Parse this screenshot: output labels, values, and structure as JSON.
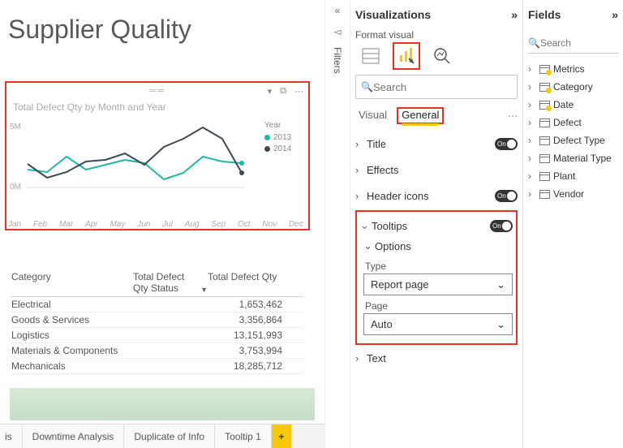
{
  "title": "Supplier Quality",
  "chart": {
    "title": "Total Defect Qty by Month and Year",
    "legend_title": "Year",
    "series": [
      {
        "name": "2013",
        "color": "#1fb8a3"
      },
      {
        "name": "2014",
        "color": "#3b4a54"
      }
    ],
    "y_ticks": [
      "5M",
      "0M"
    ],
    "x_ticks": [
      "Jan",
      "Feb",
      "Mar",
      "Apr",
      "May",
      "Jun",
      "Jul",
      "Aug",
      "Sep",
      "Oct",
      "Nov",
      "Dec"
    ]
  },
  "chart_data": {
    "type": "line",
    "title": "Total Defect Qty by Month and Year",
    "xlabel": "",
    "ylabel": "",
    "ylim": [
      0,
      6000000
    ],
    "categories": [
      "Jan",
      "Feb",
      "Mar",
      "Apr",
      "May",
      "Jun",
      "Jul",
      "Aug",
      "Sep",
      "Oct",
      "Nov",
      "Dec"
    ],
    "series": [
      {
        "name": "2013",
        "values": [
          1600000,
          1400000,
          2800000,
          1600000,
          2000000,
          2400000,
          2100000,
          700000,
          1300000,
          2700000,
          2300000,
          2200000
        ]
      },
      {
        "name": "2014",
        "values": [
          2100000,
          800000,
          1400000,
          2300000,
          2500000,
          3100000,
          2000000,
          3700000,
          4400000,
          5500000,
          4500000,
          1300000
        ]
      }
    ]
  },
  "table": {
    "headers": {
      "category": "Category",
      "status": "Total Defect Qty Status",
      "qty": "Total Defect Qty"
    },
    "rows": [
      {
        "category": "Electrical",
        "qty": "1,653,462"
      },
      {
        "category": "Goods & Services",
        "qty": "3,356,864"
      },
      {
        "category": "Logistics",
        "qty": "13,151,993"
      },
      {
        "category": "Materials & Components",
        "qty": "3,753,994"
      },
      {
        "category": "Mechanicals",
        "qty": "18,285,712"
      }
    ]
  },
  "tabs": [
    "is",
    "Downtime Analysis",
    "Duplicate of Info",
    "Tooltip 1"
  ],
  "filters_label": "Filters",
  "viz": {
    "title": "Visualizations",
    "subtitle": "Format visual",
    "search_placeholder": "Search",
    "tabs": {
      "visual": "Visual",
      "general": "General"
    },
    "sections": {
      "title": "Title",
      "effects": "Effects",
      "header": "Header icons",
      "tooltips": "Tooltips",
      "text": "Text"
    },
    "toggle_on": "On",
    "tooltips": {
      "options": "Options",
      "type_label": "Type",
      "type_value": "Report page",
      "page_label": "Page",
      "page_value": "Auto"
    }
  },
  "fields": {
    "title": "Fields",
    "search_placeholder": "Search",
    "items": [
      {
        "name": "Metrics",
        "checked": true
      },
      {
        "name": "Category",
        "checked": true
      },
      {
        "name": "Date",
        "checked": true
      },
      {
        "name": "Defect",
        "checked": false
      },
      {
        "name": "Defect Type",
        "checked": false
      },
      {
        "name": "Material Type",
        "checked": false
      },
      {
        "name": "Plant",
        "checked": false
      },
      {
        "name": "Vendor",
        "checked": false
      }
    ]
  }
}
